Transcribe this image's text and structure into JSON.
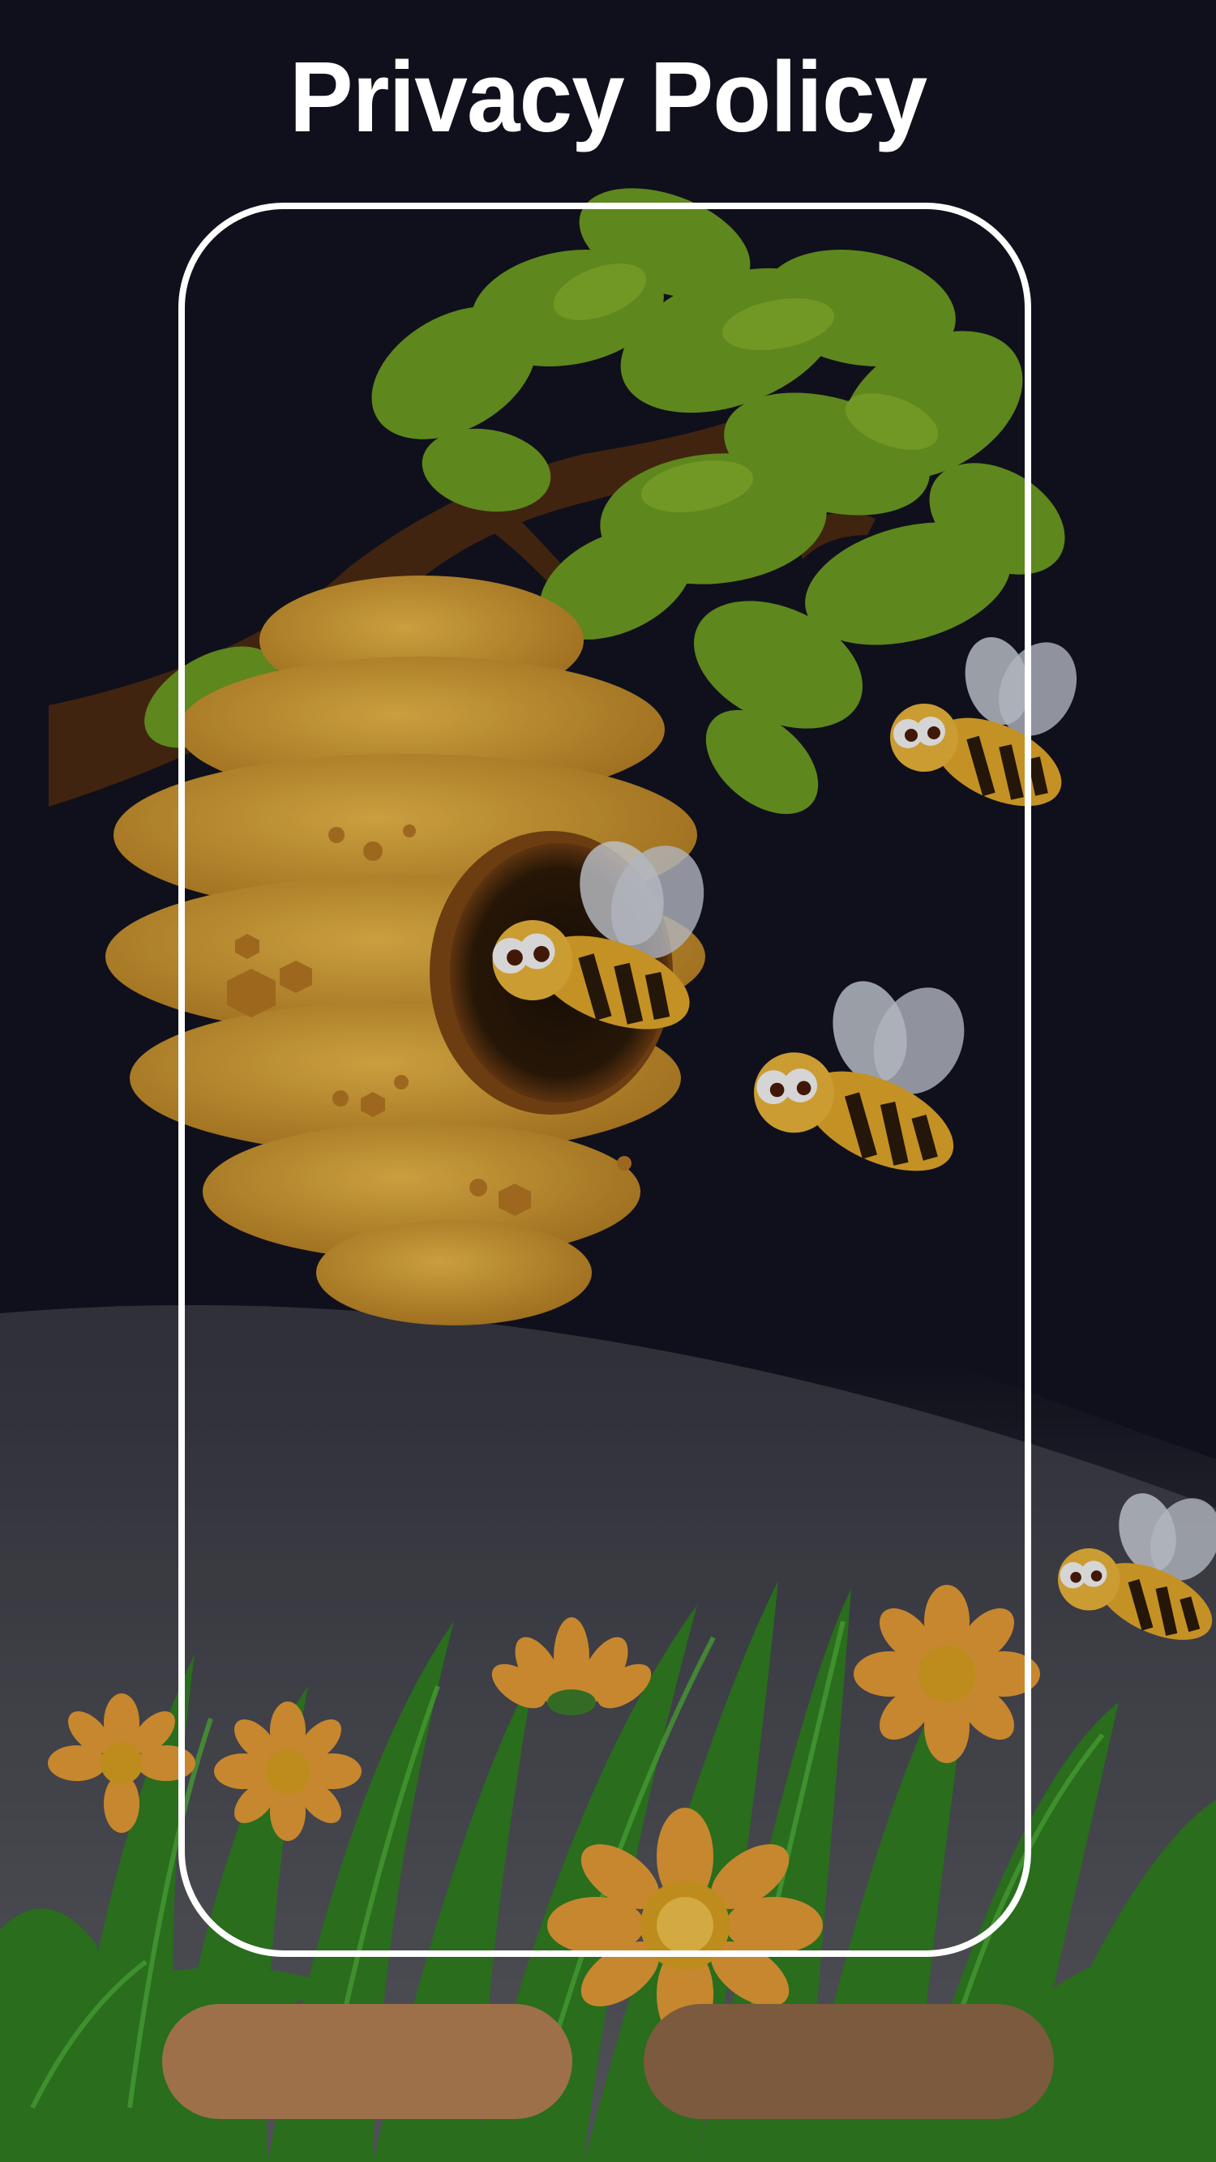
{
  "page": {
    "title": "Privacy Policy"
  },
  "buttons": {
    "left": {
      "color": "#9d7049"
    },
    "right": {
      "color": "#7c5a3d"
    }
  },
  "scene": {
    "sky_color": "#12131f",
    "mist_color": "#6a6a72",
    "grass_color": "#2f7d22",
    "leaf_color": "#6c9a22",
    "hive_color": "#d6a23a",
    "flower_color": "#e39a36",
    "bee_count": 4
  }
}
